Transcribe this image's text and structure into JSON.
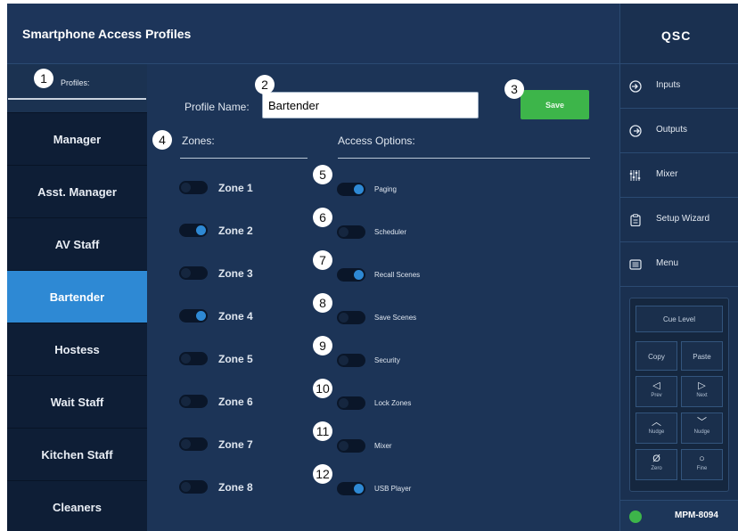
{
  "header": {
    "title": "Smartphone Access Profiles"
  },
  "profiles": {
    "label": "Profiles:",
    "items": [
      "Manager",
      "Asst. Manager",
      "AV Staff",
      "Bartender",
      "Hostess",
      "Wait Staff",
      "Kitchen Staff",
      "Cleaners"
    ],
    "selected": "Bartender"
  },
  "form": {
    "profile_name_label": "Profile Name:",
    "profile_name_value": "Bartender",
    "save_label": "Save"
  },
  "zones": {
    "header": "Zones:",
    "items": [
      {
        "label": "Zone 1",
        "on": false
      },
      {
        "label": "Zone 2",
        "on": true
      },
      {
        "label": "Zone 3",
        "on": false
      },
      {
        "label": "Zone 4",
        "on": true
      },
      {
        "label": "Zone 5",
        "on": false
      },
      {
        "label": "Zone 6",
        "on": false
      },
      {
        "label": "Zone 7",
        "on": false
      },
      {
        "label": "Zone 8",
        "on": false
      }
    ]
  },
  "access_options": {
    "header": "Access Options:",
    "items": [
      {
        "label": "Paging",
        "on": true
      },
      {
        "label": "Scheduler",
        "on": false
      },
      {
        "label": "Recall Scenes",
        "on": true
      },
      {
        "label": "Save Scenes",
        "on": false
      },
      {
        "label": "Security",
        "on": false
      },
      {
        "label": "Lock Zones",
        "on": false
      },
      {
        "label": "Mixer",
        "on": false
      },
      {
        "label": "USB Player",
        "on": true
      }
    ]
  },
  "callouts": [
    "1",
    "2",
    "3",
    "4",
    "5",
    "6",
    "7",
    "8",
    "9",
    "10",
    "11",
    "12"
  ],
  "brand": {
    "logo": "QSC"
  },
  "nav": {
    "items": [
      {
        "label": "Inputs",
        "icon": "input-arrow-icon"
      },
      {
        "label": "Outputs",
        "icon": "output-arrow-icon"
      },
      {
        "label": "Mixer",
        "icon": "mixer-faders-icon"
      },
      {
        "label": "Setup Wizard",
        "icon": "clipboard-icon"
      },
      {
        "label": "Menu",
        "icon": "menu-list-icon"
      }
    ]
  },
  "control_panel": {
    "cue_level": "Cue Level",
    "copy": "Copy",
    "paste": "Paste",
    "prev_symbol": "◁",
    "prev": "Prev",
    "next_symbol": "▷",
    "next": "Next",
    "nudge_up_symbol": "︿",
    "nudge_down_symbol": "﹀",
    "nudge": "Nudge",
    "zero_symbol": "Ø",
    "zero": "Zero",
    "fine_symbol": "○",
    "fine": "Fine"
  },
  "device": {
    "name": "MPM-8094",
    "status_color": "#3db54a"
  },
  "colors": {
    "accent": "#2e89d4",
    "save": "#3db54a",
    "background": "#1b3251"
  }
}
